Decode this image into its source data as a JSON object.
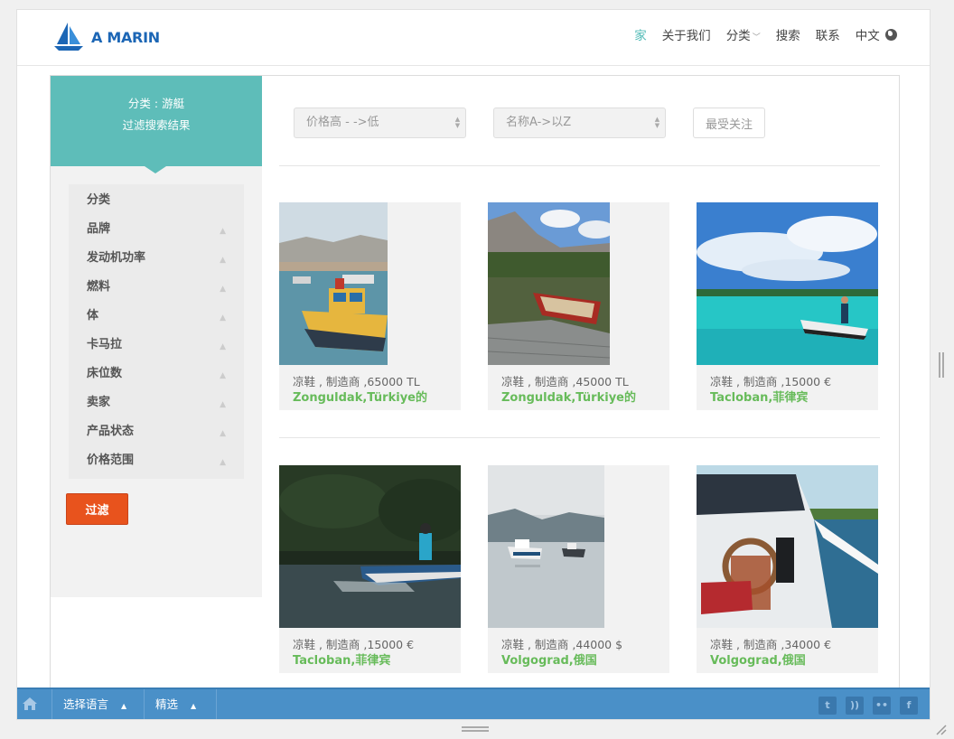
{
  "header": {
    "logo_text": "A MARIN",
    "nav": [
      {
        "label": "家",
        "active": true
      },
      {
        "label": "关于我们"
      },
      {
        "label": "分类"
      },
      {
        "label": "搜索"
      },
      {
        "label": "联系"
      },
      {
        "label": "中文"
      }
    ]
  },
  "sidebar": {
    "title_line1": "分类 : 游艇",
    "title_line2": "过滤搜索结果",
    "filters": [
      "分类",
      "品牌",
      "发动机功率",
      "燃料",
      "体",
      "卡马拉",
      "床位数",
      "卖家",
      "产品状态",
      "价格范围"
    ],
    "filter_button": "过滤"
  },
  "controls": {
    "sort_price": "价格高 - ->低",
    "sort_name": "名称A->以Z",
    "favorites_button": "最受关注"
  },
  "listings": [
    {
      "info": "凉鞋 , 制造商 ,65000 TL",
      "location": "Zonguldak,Türkiye的"
    },
    {
      "info": "凉鞋 , 制造商 ,45000 TL",
      "location": "Zonguldak,Türkiye的"
    },
    {
      "info": "凉鞋 , 制造商 ,15000 €",
      "location": "Tacloban,菲律宾"
    },
    {
      "info": "凉鞋 , 制造商 ,15000 €",
      "location": "Tacloban,菲律宾"
    },
    {
      "info": "凉鞋 , 制造商 ,44000 $",
      "location": "Volgograd,俄国"
    },
    {
      "info": "凉鞋 , 制造商 ,34000 €",
      "location": "Volgograd,俄国"
    }
  ],
  "bottombar": {
    "language_label": "选择语言",
    "featured_label": "精选",
    "social": [
      "twitter-icon",
      "rss-icon",
      "flickr-icon",
      "facebook-icon"
    ]
  },
  "colors": {
    "accent": "#5ebdb9",
    "filter_button": "#e8531d",
    "location_text": "#67bb5a",
    "bottombar": "#4a90c8"
  }
}
